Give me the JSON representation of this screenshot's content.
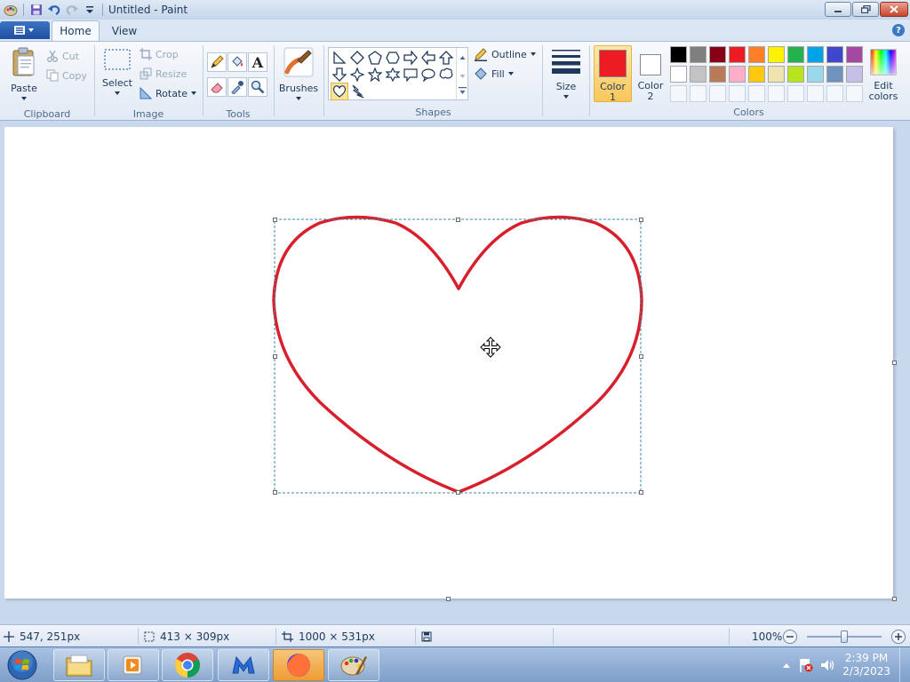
{
  "window": {
    "title": "Untitled - Paint"
  },
  "tabs": [
    {
      "label": "Home"
    },
    {
      "label": "View"
    }
  ],
  "help_label": "?",
  "clipboard": {
    "paste": "Paste",
    "cut": "Cut",
    "copy": "Copy",
    "group": "Clipboard"
  },
  "image": {
    "select": "Select",
    "crop": "Crop",
    "resize": "Resize",
    "rotate": "Rotate",
    "group": "Image"
  },
  "tools": {
    "group": "Tools",
    "text_tool": "A"
  },
  "brushes": {
    "label": "Brushes"
  },
  "shapes": {
    "outline": "Outline",
    "fill": "Fill",
    "group": "Shapes"
  },
  "size": {
    "label": "Size"
  },
  "colors": {
    "color1_label": "Color",
    "color1_num": "1",
    "color2_label": "Color",
    "color2_num": "2",
    "edit_label": "Edit",
    "edit_label2": "colors",
    "group": "Colors",
    "color1": "#ed1c24",
    "color2": "#ffffff",
    "palette_row1": [
      "#000000",
      "#7f7f7f",
      "#880015",
      "#ed1c24",
      "#ff7f27",
      "#fff200",
      "#22b14c",
      "#00a2e8",
      "#3f48cc",
      "#a349a4"
    ],
    "palette_row2": [
      "#ffffff",
      "#c3c3c3",
      "#b97a57",
      "#ffaec9",
      "#ffc90e",
      "#efe4b0",
      "#b5e61d",
      "#99d9ea",
      "#7092be",
      "#c8bfe7"
    ]
  },
  "canvas": {
    "stroke_color": "#d7202c"
  },
  "status": {
    "cursor_pos": "547, 251px",
    "selection_size": "413 × 309px",
    "canvas_size": "1000 × 531px",
    "zoom": "100%"
  },
  "clock": {
    "time": "2:39 PM",
    "date": "2/3/2023"
  }
}
